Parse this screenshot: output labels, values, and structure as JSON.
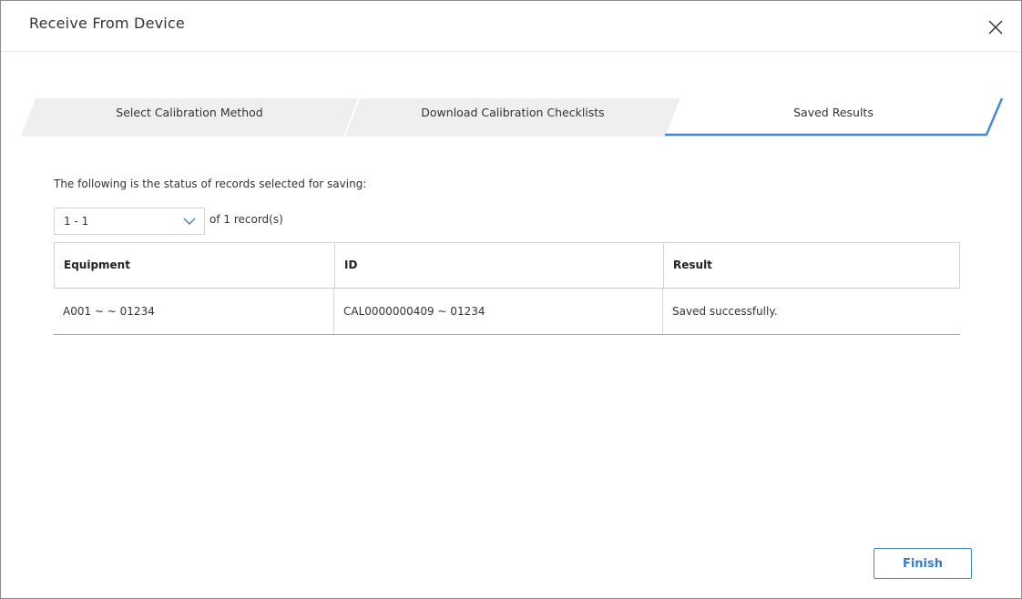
{
  "dialog": {
    "title": "Receive From Device"
  },
  "wizard": {
    "steps": [
      {
        "label": "Select Calibration Method",
        "state": "done"
      },
      {
        "label": "Download Calibration Checklists",
        "state": "done"
      },
      {
        "label": "Saved Results",
        "state": "active"
      }
    ],
    "colors": {
      "inactive_fill": "#efefef",
      "active_underline": "#3f87d8"
    }
  },
  "status": {
    "text": "The following is the status of records selected for saving:"
  },
  "pager": {
    "selected_range": "1 - 1",
    "total_text": "of 1 record(s)"
  },
  "grid": {
    "columns": [
      "Equipment",
      "ID",
      "Result"
    ],
    "rows": [
      [
        "A001 ~ ~ 01234",
        "CAL0000000409 ~ 01234",
        "Saved successfully."
      ]
    ]
  },
  "footer": {
    "finish_label": "Finish"
  },
  "icons": {
    "close": "close-icon",
    "dropdown": "chevron-down-icon"
  }
}
